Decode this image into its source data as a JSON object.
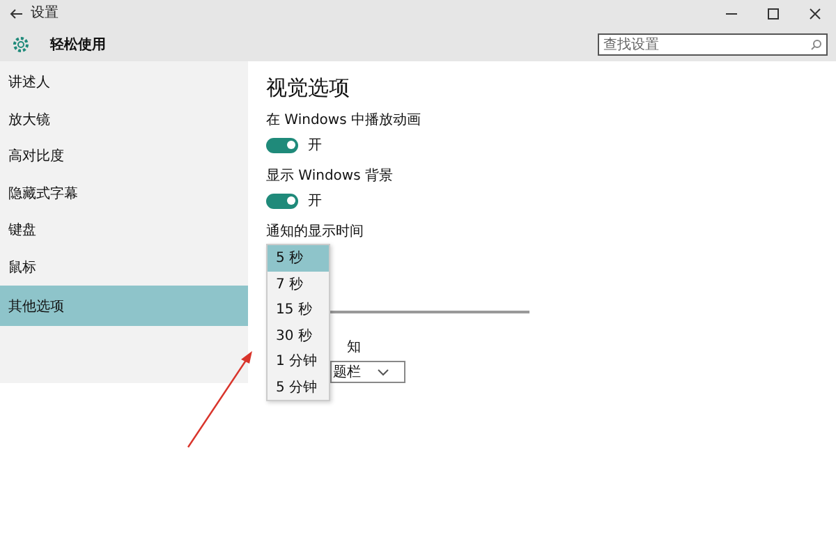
{
  "window": {
    "title": "设置"
  },
  "header": {
    "title": "轻松使用",
    "search": {
      "placeholder": "查找设置"
    }
  },
  "sidebar": {
    "items": [
      {
        "label": "讲述人",
        "selected": false
      },
      {
        "label": "放大镜",
        "selected": false
      },
      {
        "label": "高对比度",
        "selected": false
      },
      {
        "label": "隐藏式字幕",
        "selected": false
      },
      {
        "label": "键盘",
        "selected": false
      },
      {
        "label": "鼠标",
        "selected": false
      },
      {
        "label": "其他选项",
        "selected": true
      }
    ]
  },
  "content": {
    "heading": "视觉选项",
    "toggles": [
      {
        "label": "在 Windows 中播放动画",
        "on": true,
        "state_text": "开"
      },
      {
        "label": "显示 Windows 背景",
        "on": true,
        "state_text": "开"
      }
    ],
    "notification_time": {
      "label": "通知的显示时间",
      "options": [
        {
          "label": "5 秒",
          "selected": true
        },
        {
          "label": "7 秒",
          "selected": false
        },
        {
          "label": "15 秒",
          "selected": false
        },
        {
          "label": "30 秒",
          "selected": false
        },
        {
          "label": "1 分钟",
          "selected": false
        },
        {
          "label": "5 分钟",
          "selected": false
        }
      ]
    },
    "covered_label": "知",
    "covered_select": {
      "value": "题栏"
    }
  }
}
